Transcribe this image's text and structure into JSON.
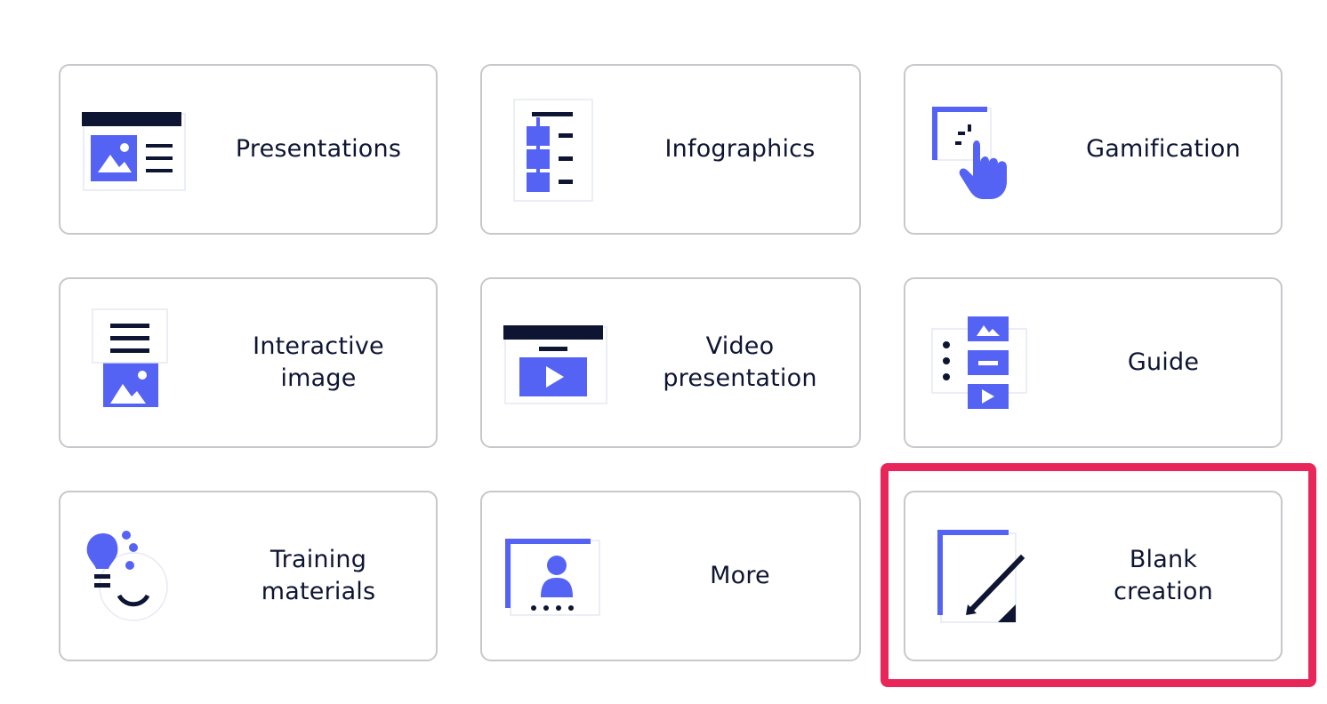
{
  "colors": {
    "accent": "#5563f5",
    "dark": "#0e1533",
    "card_border": "#c8c8cc",
    "highlight": "#e8265a"
  },
  "cards": [
    {
      "id": "presentations",
      "icon": "presentation-icon",
      "lines": [
        "Presentations"
      ]
    },
    {
      "id": "infographics",
      "icon": "infographic-icon",
      "lines": [
        "Infographics"
      ]
    },
    {
      "id": "gamification",
      "icon": "tap-hand-icon",
      "lines": [
        "Gamification"
      ]
    },
    {
      "id": "interactive-image",
      "icon": "interactive-image-icon",
      "lines": [
        "Interactive",
        "image"
      ]
    },
    {
      "id": "video-presentation",
      "icon": "video-presentation-icon",
      "lines": [
        "Video",
        "presentation"
      ]
    },
    {
      "id": "guide",
      "icon": "guide-icon",
      "lines": [
        "Guide"
      ]
    },
    {
      "id": "training-materials",
      "icon": "lightbulb-icon",
      "lines": [
        "Training",
        "materials"
      ]
    },
    {
      "id": "more",
      "icon": "more-icon",
      "lines": [
        "More"
      ]
    },
    {
      "id": "blank-creation",
      "icon": "pen-page-icon",
      "lines": [
        "Blank",
        "creation"
      ],
      "highlighted": true
    }
  ]
}
